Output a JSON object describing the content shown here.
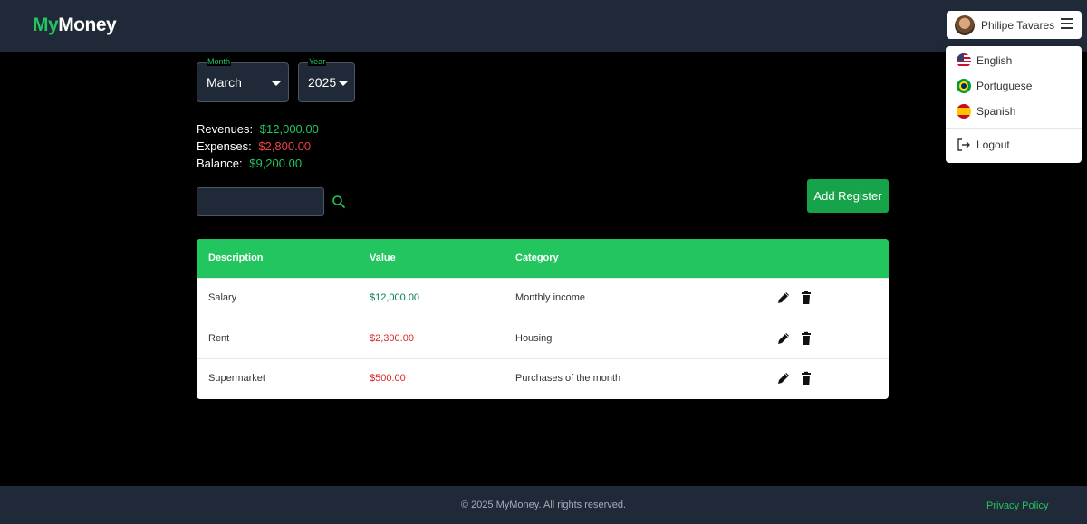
{
  "app": {
    "logo_part1": "My",
    "logo_part2": "Money"
  },
  "user": {
    "name": "Philipe Tavares"
  },
  "menu": {
    "items": [
      {
        "label": "English",
        "icon": "us-flag-icon"
      },
      {
        "label": "Portuguese",
        "icon": "brazil-flag-icon"
      },
      {
        "label": "Spanish",
        "icon": "spain-flag-icon"
      }
    ],
    "logout": "Logout"
  },
  "filters": {
    "month_label": "Month",
    "month_value": "March",
    "year_label": "Year",
    "year_value": "2025"
  },
  "summary": {
    "revenues_label": "Revenues:",
    "revenues_value": "$12,000.00",
    "expenses_label": "Expenses:",
    "expenses_value": "$2,800.00",
    "balance_label": "Balance:",
    "balance_value": "$9,200.00"
  },
  "search": {
    "placeholder": ""
  },
  "add_button": "Add Register",
  "table": {
    "headers": [
      "Description",
      "Value",
      "Category"
    ],
    "rows": [
      {
        "description": "Salary",
        "value": "$12,000.00",
        "category": "Monthly income"
      },
      {
        "description": "Rent",
        "value": "$2,300.00",
        "category": "Housing"
      },
      {
        "description": "Supermarket",
        "value": "$500.00",
        "category": "Purchases of the month"
      }
    ]
  },
  "footer": {
    "copyright": "© 2025 MyMoney. All rights reserved.",
    "privacy": "Privacy Policy"
  },
  "colors": {
    "accent": "#22c55e",
    "header_bg": "#1f2937",
    "negative": "#dc2626"
  }
}
